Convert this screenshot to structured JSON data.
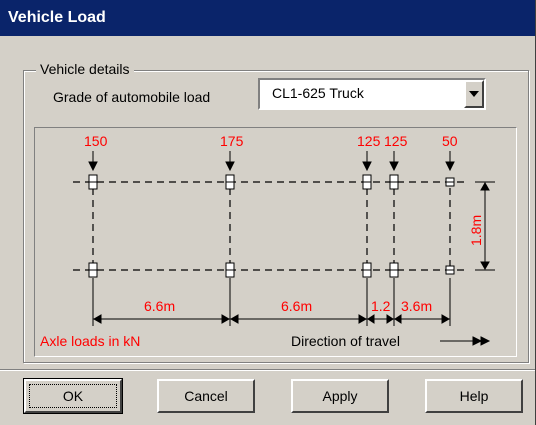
{
  "window": {
    "title": "Vehicle Load"
  },
  "group": {
    "legend": "Vehicle details",
    "grade_label": "Grade of automobile load",
    "grade_value": "CL1-625 Truck"
  },
  "diagram": {
    "axle_loads": [
      "150",
      "175",
      "125",
      "125",
      "50"
    ],
    "spacings": [
      "6.6m",
      "6.6m",
      "1.2",
      "3.6m"
    ],
    "width_label": "1.8m",
    "units_note": "Axle loads in kN",
    "direction_label": "Direction of travel"
  },
  "buttons": {
    "ok": "OK",
    "cancel": "Cancel",
    "apply": "Apply",
    "help": "Help"
  },
  "colors": {
    "title_bar": "#0a246a",
    "face": "#d4d0c8",
    "annotation_red": "#ff0000"
  }
}
